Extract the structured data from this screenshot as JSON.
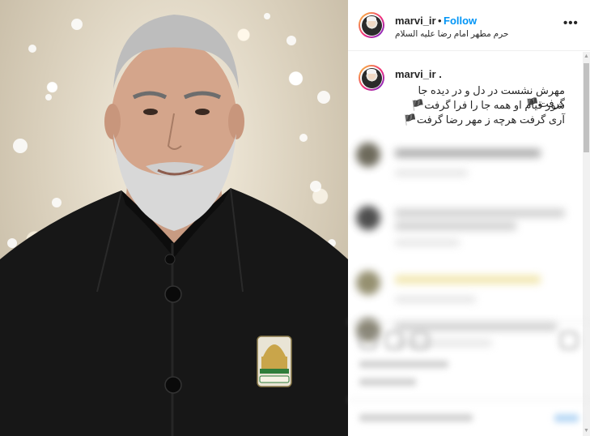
{
  "post": {
    "username": "marvi_ir",
    "separator": "•",
    "follow_label": "Follow",
    "location": "حرم مطهر امام رضا علیه السلام",
    "more_label": "•••"
  },
  "caption": {
    "username": "marvi_ir .",
    "lines": [
      "مهرش نشست در دل و در دیده جا گرفت🏴",
      "شور قیام او همه جا را فرا گرفت🏴",
      "آری گرفت هرچه ز مهر رضا گرفت🏴"
    ]
  },
  "photo": {
    "badge_text": "قاسم سلیمانی"
  },
  "scrollbar": {
    "up_arrow": "▲",
    "down_arrow": "▼"
  },
  "colors": {
    "accent": "#0095f6",
    "text": "#262626",
    "jacket": "#161616",
    "badge_green": "#2f7d3a",
    "badge_gold": "#c9a54a"
  },
  "icons": [
    "more-options-icon",
    "profile-avatar",
    "scroll-up-icon",
    "scroll-down-icon"
  ]
}
